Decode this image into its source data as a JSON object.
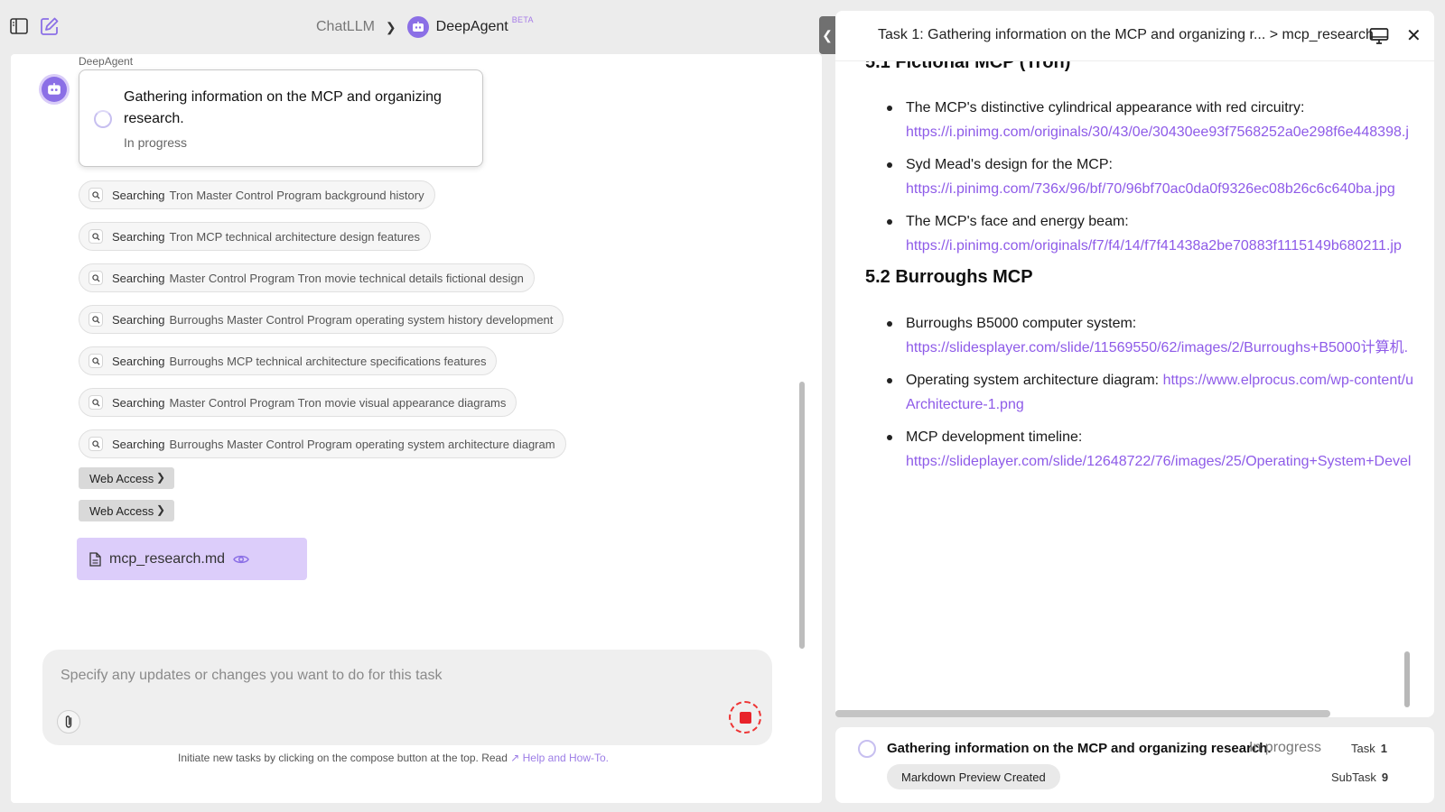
{
  "header": {
    "app_name": "ChatLLM",
    "separator": ">",
    "agent_name": "DeepAgent",
    "badge": "BETA"
  },
  "conversation": {
    "agent_label": "DeepAgent",
    "task_card": {
      "title": "Gathering information on the MCP and organizing research.",
      "status": "In progress"
    },
    "searches": [
      {
        "verb": "Searching",
        "query": "Tron Master Control Program background history"
      },
      {
        "verb": "Searching",
        "query": "Tron MCP technical architecture design features"
      },
      {
        "verb": "Searching",
        "query": "Master Control Program Tron movie technical details fictional design"
      },
      {
        "verb": "Searching",
        "query": "Burroughs Master Control Program operating system history development"
      },
      {
        "verb": "Searching",
        "query": "Burroughs MCP technical architecture specifications features"
      },
      {
        "verb": "Searching",
        "query": "Master Control Program Tron movie visual appearance diagrams"
      },
      {
        "verb": "Searching",
        "query": "Burroughs Master Control Program operating system architecture diagram"
      }
    ],
    "web_access": [
      "Web Access",
      "Web Access"
    ],
    "file": {
      "name": "mcp_research.md"
    }
  },
  "composer": {
    "placeholder": "Specify any updates or changes you want to do for this task",
    "footer_text": "Initiate new tasks by clicking on the compose button at the top. Read",
    "footer_link": "Help and How-To."
  },
  "preview": {
    "title": "Task 1: Gathering information on the MCP and organizing r... > mcp_research",
    "section1_heading": "5.1 Fictional MCP (Tron)",
    "section1_items": [
      {
        "text": "The MCP's distinctive cylindrical appearance with red circuitry:",
        "url": "https://i.pinimg.com/originals/30/43/0e/30430ee93f7568252a0e298f6e448398.j"
      },
      {
        "text": "Syd Mead's design for the MCP:",
        "url": "https://i.pinimg.com/736x/96/bf/70/96bf70ac0da0f9326ec08b26c6c640ba.jpg"
      },
      {
        "text": "The MCP's face and energy beam:",
        "url": "https://i.pinimg.com/originals/f7/f4/14/f7f41438a2be70883f1115149b680211.jp"
      }
    ],
    "section2_heading": "5.2 Burroughs MCP",
    "section2_items": [
      {
        "text": "Burroughs B5000 computer system:",
        "url": "https://slidesplayer.com/slide/11569550/62/images/2/Burroughs+B5000计算机."
      },
      {
        "text": "Operating system architecture diagram: ",
        "url": "https://www.elprocus.com/wp-content/u",
        "url_cont": "Architecture-1.png"
      },
      {
        "text": "MCP development timeline:",
        "url": "https://slideplayer.com/slide/12648722/76/images/25/Operating+System+Devel"
      }
    ]
  },
  "status_bar": {
    "title": "Gathering information on the MCP and organizing research.",
    "progress": "In progress",
    "badge": "Markdown Preview Created",
    "task_label": "Task",
    "task_num": "1",
    "subtask_label": "SubTask",
    "subtask_num": "9"
  },
  "colors": {
    "accent": "#8b6fe6",
    "link": "#8e5be8",
    "file_chip": "#dccdfa",
    "stop": "#e8232a"
  }
}
